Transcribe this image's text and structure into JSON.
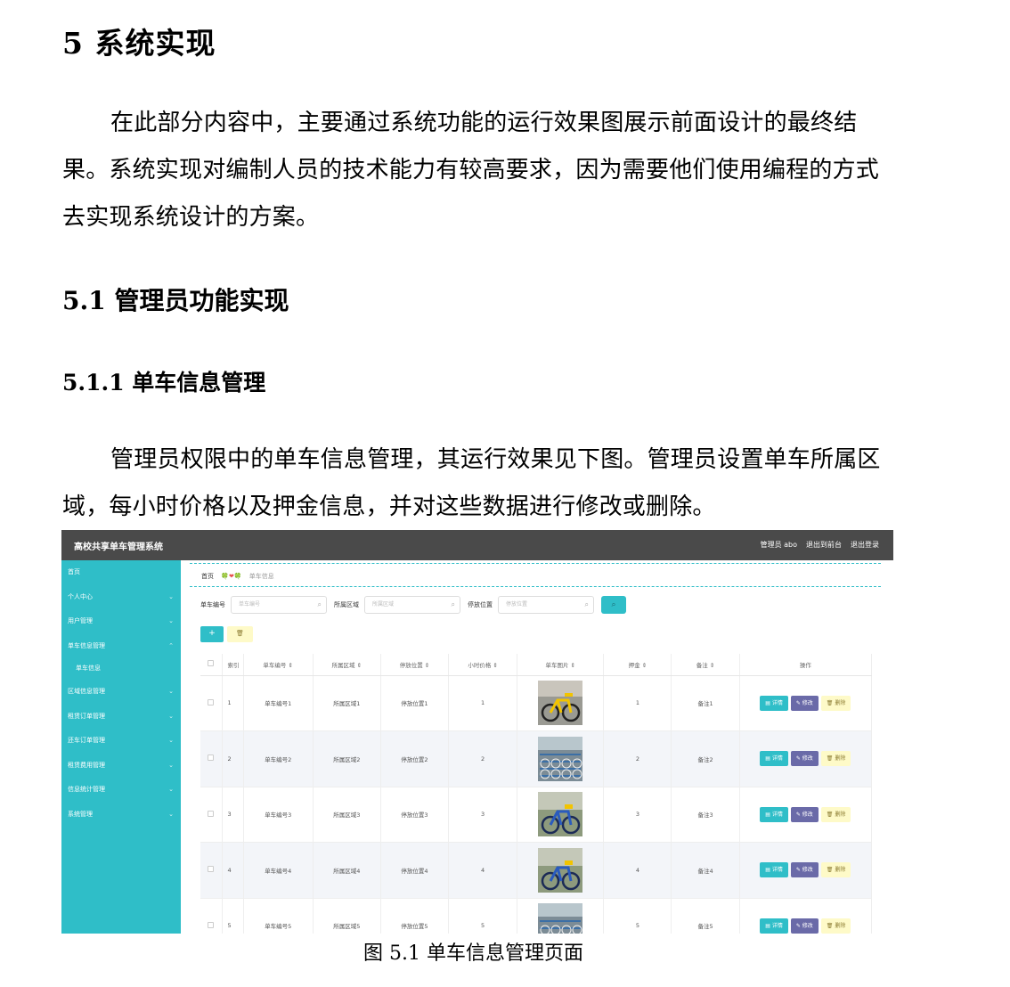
{
  "doc": {
    "h1": "5  系统实现",
    "intro": "在此部分内容中，主要通过系统功能的运行效果图展示前面设计的最终结果。系统实现对编制人员的技术能力有较高要求，因为需要他们使用编程的方式去实现系统设计的方案。",
    "h2": "5.1  管理员功能实现",
    "h3": "5.1.1  单车信息管理",
    "para": "管理员权限中的单车信息管理，其运行效果见下图。管理员设置单车所属区域，每小时价格以及押金信息，并对这些数据进行修改或删除。",
    "caption": "图 5.1  单车信息管理页面"
  },
  "app": {
    "title": "高校共享单车管理系统",
    "top_links": [
      "管理员 abo",
      "退出到前台",
      "退出登录"
    ],
    "sidebar": [
      {
        "label": "首页",
        "chevron": ""
      },
      {
        "label": "个人中心",
        "chevron": "⌄"
      },
      {
        "label": "用户管理",
        "chevron": "⌄"
      },
      {
        "label": "单车信息管理",
        "chevron": "⌃"
      },
      {
        "label": "区域信息管理",
        "chevron": "⌄"
      },
      {
        "label": "租赁订单管理",
        "chevron": "⌄"
      },
      {
        "label": "还车订单管理",
        "chevron": "⌄"
      },
      {
        "label": "租赁费用管理",
        "chevron": "⌄"
      },
      {
        "label": "信息统计管理",
        "chevron": "⌄"
      },
      {
        "label": "系统管理",
        "chevron": "⌄"
      }
    ],
    "sidebar_sub": "单车信息",
    "breadcrumb": {
      "home": "首页",
      "deco": "🍀❤🍀",
      "current": "单车信息"
    },
    "search": {
      "bike_no_label": "单车编号",
      "bike_no_placeholder": "单车编号",
      "area_label": "所属区域",
      "area_placeholder": "所属区域",
      "park_label": "停放位置",
      "park_placeholder": "停放位置",
      "search_icon": "search-icon"
    },
    "buttons": {
      "add": "+",
      "batch_delete": "🗑"
    },
    "columns": [
      "索引",
      "单车编号 ⇕",
      "所属区域 ⇕",
      "停放位置 ⇕",
      "小时价格 ⇕",
      "单车图片 ⇕",
      "押金 ⇕",
      "备注 ⇕",
      "操作"
    ],
    "op_labels": {
      "detail": "▤ 详情",
      "edit": "✎ 修改",
      "delete": "🗑 删除"
    },
    "rows": [
      {
        "idx": "1",
        "bike_no": "单车编号1",
        "area": "所属区域1",
        "park": "停放位置1",
        "price": "1",
        "deposit": "1",
        "note": "备注1",
        "photo": "yellow-bike"
      },
      {
        "idx": "2",
        "bike_no": "单车编号2",
        "area": "所属区域2",
        "park": "停放位置2",
        "price": "2",
        "deposit": "2",
        "note": "备注2",
        "photo": "bike-rows"
      },
      {
        "idx": "3",
        "bike_no": "单车编号3",
        "area": "所属区域3",
        "park": "停放位置3",
        "price": "3",
        "deposit": "3",
        "note": "备注3",
        "photo": "blue-yellow-bike"
      },
      {
        "idx": "4",
        "bike_no": "单车编号4",
        "area": "所属区域4",
        "park": "停放位置4",
        "price": "4",
        "deposit": "4",
        "note": "备注4",
        "photo": "blue-yellow-bike"
      },
      {
        "idx": "5",
        "bike_no": "单车编号5",
        "area": "所属区域5",
        "park": "停放位置5",
        "price": "5",
        "deposit": "5",
        "note": "备注5",
        "photo": "bike-rows"
      }
    ]
  }
}
